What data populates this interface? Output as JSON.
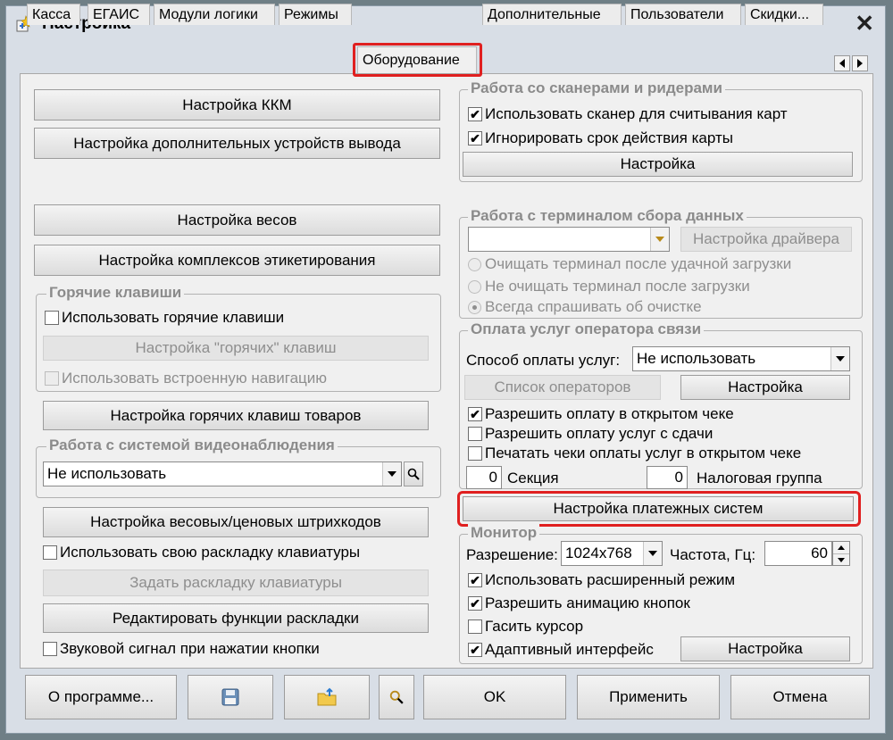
{
  "window": {
    "title": "Настройка",
    "close": "✕"
  },
  "tabs": [
    {
      "label": "Касса"
    },
    {
      "label": "ЕГАИС"
    },
    {
      "label": "Модули логики"
    },
    {
      "label": "Режимы"
    },
    {
      "label": "Оборудование"
    },
    {
      "label": "Дополнительные"
    },
    {
      "label": "Пользователи"
    },
    {
      "label": "Скидки..."
    }
  ],
  "left": {
    "kkm": "Настройка ККМ",
    "output_devices": "Настройка дополнительных устройств вывода",
    "scales": "Настройка весов",
    "labeling": "Настройка комплексов этикетирования",
    "hotkeys_group": "Горячие клавиши",
    "use_hotkeys": "Использовать горячие клавиши",
    "hotkeys_setup": "Настройка \"горячих\" клавиш",
    "builtin_nav": "Использовать встроенную навигацию",
    "product_hotkeys": "Настройка горячих клавиш товаров",
    "video_group": "Работа с системой видеонаблюдения",
    "video_value": "Не использовать",
    "barcodes": "Настройка весовых/ценовых штрихкодов",
    "own_layout": "Использовать свою раскладку клавиатуры",
    "set_layout": "Задать раскладку клавиатуры",
    "edit_layout": "Редактировать функции раскладки",
    "beep": "Звуковой сигнал при нажатии кнопки"
  },
  "scanners": {
    "group": "Работа со сканерами и ридерами",
    "use_scanner": "Использовать сканер для считывания карт",
    "ignore_expiry": "Игнорировать срок действия карты",
    "setup": "Настройка"
  },
  "terminal": {
    "group": "Работа с терминалом сбора данных",
    "combo_value": "",
    "driver_setup": "Настройка драйвера",
    "radio1": "Очищать терминал после удачной загрузки",
    "radio2": "Не очищать терминал после загрузки",
    "radio3": "Всегда спрашивать об очистке"
  },
  "operator": {
    "group": "Оплата услуг оператора связи",
    "method_label": "Способ оплаты услуг:",
    "method_value": "Не использовать",
    "operators_list": "Список операторов",
    "setup": "Настройка",
    "allow_open": "Разрешить оплату в открытом чеке",
    "allow_change": "Разрешить оплату услуг с сдачи",
    "print_checks": "Печатать чеки оплаты услуг в открытом чеке",
    "section_value": "0",
    "section_label": "Секция",
    "tax_value": "0",
    "tax_label": "Налоговая группа"
  },
  "payment_systems": "Настройка платежных систем",
  "monitor": {
    "group": "Монитор",
    "resolution_label": "Разрешение:",
    "resolution_value": "1024x768",
    "freq_label": "Частота, Гц:",
    "freq_value": "60",
    "extended": "Использовать расширенный режим",
    "animation": "Разрешить анимацию кнопок",
    "hide_cursor": "Гасить курсор",
    "adaptive": "Адаптивный интерфейс",
    "setup": "Настройка"
  },
  "footer": {
    "about": "О программе...",
    "ok": "OK",
    "apply": "Применить",
    "cancel": "Отмена"
  },
  "check_mark": "✔",
  "accent_red": "#e02020"
}
